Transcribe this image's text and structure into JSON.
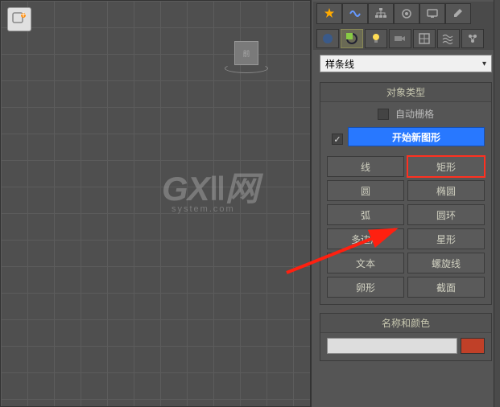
{
  "viewport": {
    "gizmo_label": "前"
  },
  "watermark": {
    "main": "GX‖网",
    "sub": "system.com"
  },
  "panel": {
    "dropdown_selected": "样条线",
    "object_type": {
      "title": "对象类型",
      "autogrid_label": "自动栅格",
      "autogrid_checked": false,
      "start_new_checked": true,
      "start_new_label": "开始新图形",
      "shapes": [
        {
          "label": "线",
          "highlight": false
        },
        {
          "label": "矩形",
          "highlight": true
        },
        {
          "label": "圆",
          "highlight": false
        },
        {
          "label": "椭圆",
          "highlight": false
        },
        {
          "label": "弧",
          "highlight": false
        },
        {
          "label": "圆环",
          "highlight": false
        },
        {
          "label": "多边形",
          "highlight": false
        },
        {
          "label": "星形",
          "highlight": false
        },
        {
          "label": "文本",
          "highlight": false
        },
        {
          "label": "螺旋线",
          "highlight": false
        },
        {
          "label": "卵形",
          "highlight": false
        },
        {
          "label": "截面",
          "highlight": false
        }
      ]
    },
    "name_color": {
      "title": "名称和颜色",
      "name_value": "",
      "color": "#c04028"
    }
  }
}
